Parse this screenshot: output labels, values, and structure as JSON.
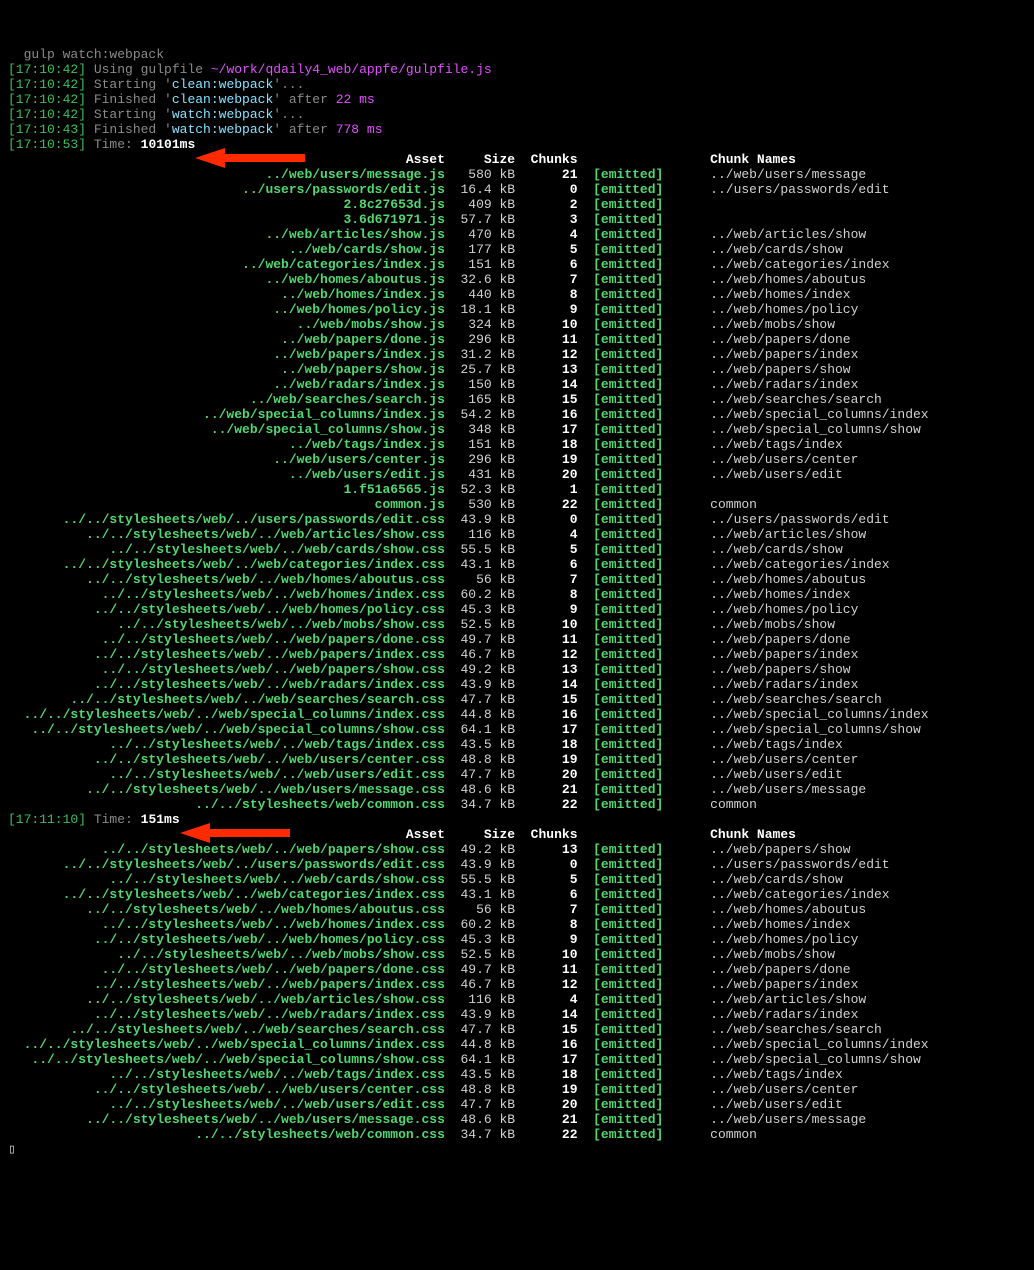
{
  "prompt_fragment": "gulp watch:webpack",
  "log_lines": [
    {
      "ts": "17:10:42",
      "type": "using",
      "text_a": "Using gulpfile ",
      "path": "~/work/qdaily4_web/appfe/gulpfile.js"
    },
    {
      "ts": "17:10:42",
      "type": "starting",
      "task": "clean:webpack"
    },
    {
      "ts": "17:10:42",
      "type": "finished",
      "task": "clean:webpack",
      "after": "22 ms"
    },
    {
      "ts": "17:10:42",
      "type": "starting",
      "task": "watch:webpack"
    },
    {
      "ts": "17:10:43",
      "type": "finished",
      "task": "watch:webpack",
      "after": "778 ms"
    }
  ],
  "build1": {
    "ts": "17:10:53",
    "time": "10101ms",
    "headers": [
      "Asset",
      "Size",
      "Chunks",
      "",
      "Chunk Names"
    ],
    "rows": [
      {
        "asset": "../web/users/message.js",
        "size": "580 kB",
        "chunk": "21",
        "status": "[emitted]",
        "name": "../web/users/message"
      },
      {
        "asset": "../users/passwords/edit.js",
        "size": "16.4 kB",
        "chunk": "0",
        "status": "[emitted]",
        "name": "../users/passwords/edit"
      },
      {
        "asset": "2.8c27653d.js",
        "size": "409 kB",
        "chunk": "2",
        "status": "[emitted]",
        "name": ""
      },
      {
        "asset": "3.6d671971.js",
        "size": "57.7 kB",
        "chunk": "3",
        "status": "[emitted]",
        "name": ""
      },
      {
        "asset": "../web/articles/show.js",
        "size": "470 kB",
        "chunk": "4",
        "status": "[emitted]",
        "name": "../web/articles/show"
      },
      {
        "asset": "../web/cards/show.js",
        "size": "177 kB",
        "chunk": "5",
        "status": "[emitted]",
        "name": "../web/cards/show"
      },
      {
        "asset": "../web/categories/index.js",
        "size": "151 kB",
        "chunk": "6",
        "status": "[emitted]",
        "name": "../web/categories/index"
      },
      {
        "asset": "../web/homes/aboutus.js",
        "size": "32.6 kB",
        "chunk": "7",
        "status": "[emitted]",
        "name": "../web/homes/aboutus"
      },
      {
        "asset": "../web/homes/index.js",
        "size": "440 kB",
        "chunk": "8",
        "status": "[emitted]",
        "name": "../web/homes/index"
      },
      {
        "asset": "../web/homes/policy.js",
        "size": "18.1 kB",
        "chunk": "9",
        "status": "[emitted]",
        "name": "../web/homes/policy"
      },
      {
        "asset": "../web/mobs/show.js",
        "size": "324 kB",
        "chunk": "10",
        "status": "[emitted]",
        "name": "../web/mobs/show"
      },
      {
        "asset": "../web/papers/done.js",
        "size": "296 kB",
        "chunk": "11",
        "status": "[emitted]",
        "name": "../web/papers/done"
      },
      {
        "asset": "../web/papers/index.js",
        "size": "31.2 kB",
        "chunk": "12",
        "status": "[emitted]",
        "name": "../web/papers/index"
      },
      {
        "asset": "../web/papers/show.js",
        "size": "25.7 kB",
        "chunk": "13",
        "status": "[emitted]",
        "name": "../web/papers/show"
      },
      {
        "asset": "../web/radars/index.js",
        "size": "150 kB",
        "chunk": "14",
        "status": "[emitted]",
        "name": "../web/radars/index"
      },
      {
        "asset": "../web/searches/search.js",
        "size": "165 kB",
        "chunk": "15",
        "status": "[emitted]",
        "name": "../web/searches/search"
      },
      {
        "asset": "../web/special_columns/index.js",
        "size": "54.2 kB",
        "chunk": "16",
        "status": "[emitted]",
        "name": "../web/special_columns/index"
      },
      {
        "asset": "../web/special_columns/show.js",
        "size": "348 kB",
        "chunk": "17",
        "status": "[emitted]",
        "name": "../web/special_columns/show"
      },
      {
        "asset": "../web/tags/index.js",
        "size": "151 kB",
        "chunk": "18",
        "status": "[emitted]",
        "name": "../web/tags/index"
      },
      {
        "asset": "../web/users/center.js",
        "size": "296 kB",
        "chunk": "19",
        "status": "[emitted]",
        "name": "../web/users/center"
      },
      {
        "asset": "../web/users/edit.js",
        "size": "431 kB",
        "chunk": "20",
        "status": "[emitted]",
        "name": "../web/users/edit"
      },
      {
        "asset": "1.f51a6565.js",
        "size": "52.3 kB",
        "chunk": "1",
        "status": "[emitted]",
        "name": ""
      },
      {
        "asset": "common.js",
        "size": "530 kB",
        "chunk": "22",
        "status": "[emitted]",
        "name": "common"
      },
      {
        "asset": "../../stylesheets/web/../users/passwords/edit.css",
        "size": "43.9 kB",
        "chunk": "0",
        "status": "[emitted]",
        "name": "../users/passwords/edit"
      },
      {
        "asset": "../../stylesheets/web/../web/articles/show.css",
        "size": "116 kB",
        "chunk": "4",
        "status": "[emitted]",
        "name": "../web/articles/show"
      },
      {
        "asset": "../../stylesheets/web/../web/cards/show.css",
        "size": "55.5 kB",
        "chunk": "5",
        "status": "[emitted]",
        "name": "../web/cards/show"
      },
      {
        "asset": "../../stylesheets/web/../web/categories/index.css",
        "size": "43.1 kB",
        "chunk": "6",
        "status": "[emitted]",
        "name": "../web/categories/index"
      },
      {
        "asset": "../../stylesheets/web/../web/homes/aboutus.css",
        "size": "56 kB",
        "chunk": "7",
        "status": "[emitted]",
        "name": "../web/homes/aboutus"
      },
      {
        "asset": "../../stylesheets/web/../web/homes/index.css",
        "size": "60.2 kB",
        "chunk": "8",
        "status": "[emitted]",
        "name": "../web/homes/index"
      },
      {
        "asset": "../../stylesheets/web/../web/homes/policy.css",
        "size": "45.3 kB",
        "chunk": "9",
        "status": "[emitted]",
        "name": "../web/homes/policy"
      },
      {
        "asset": "../../stylesheets/web/../web/mobs/show.css",
        "size": "52.5 kB",
        "chunk": "10",
        "status": "[emitted]",
        "name": "../web/mobs/show"
      },
      {
        "asset": "../../stylesheets/web/../web/papers/done.css",
        "size": "49.7 kB",
        "chunk": "11",
        "status": "[emitted]",
        "name": "../web/papers/done"
      },
      {
        "asset": "../../stylesheets/web/../web/papers/index.css",
        "size": "46.7 kB",
        "chunk": "12",
        "status": "[emitted]",
        "name": "../web/papers/index"
      },
      {
        "asset": "../../stylesheets/web/../web/papers/show.css",
        "size": "49.2 kB",
        "chunk": "13",
        "status": "[emitted]",
        "name": "../web/papers/show"
      },
      {
        "asset": "../../stylesheets/web/../web/radars/index.css",
        "size": "43.9 kB",
        "chunk": "14",
        "status": "[emitted]",
        "name": "../web/radars/index"
      },
      {
        "asset": "../../stylesheets/web/../web/searches/search.css",
        "size": "47.7 kB",
        "chunk": "15",
        "status": "[emitted]",
        "name": "../web/searches/search"
      },
      {
        "asset": "../../stylesheets/web/../web/special_columns/index.css",
        "size": "44.8 kB",
        "chunk": "16",
        "status": "[emitted]",
        "name": "../web/special_columns/index"
      },
      {
        "asset": "../../stylesheets/web/../web/special_columns/show.css",
        "size": "64.1 kB",
        "chunk": "17",
        "status": "[emitted]",
        "name": "../web/special_columns/show"
      },
      {
        "asset": "../../stylesheets/web/../web/tags/index.css",
        "size": "43.5 kB",
        "chunk": "18",
        "status": "[emitted]",
        "name": "../web/tags/index"
      },
      {
        "asset": "../../stylesheets/web/../web/users/center.css",
        "size": "48.8 kB",
        "chunk": "19",
        "status": "[emitted]",
        "name": "../web/users/center"
      },
      {
        "asset": "../../stylesheets/web/../web/users/edit.css",
        "size": "47.7 kB",
        "chunk": "20",
        "status": "[emitted]",
        "name": "../web/users/edit"
      },
      {
        "asset": "../../stylesheets/web/../web/users/message.css",
        "size": "48.6 kB",
        "chunk": "21",
        "status": "[emitted]",
        "name": "../web/users/message"
      },
      {
        "asset": "../../stylesheets/web/common.css",
        "size": "34.7 kB",
        "chunk": "22",
        "status": "[emitted]",
        "name": "common"
      }
    ]
  },
  "build2": {
    "ts": "17:11:10",
    "time": "151ms",
    "headers": [
      "Asset",
      "Size",
      "Chunks",
      "",
      "Chunk Names"
    ],
    "rows": [
      {
        "asset": "../../stylesheets/web/../web/papers/show.css",
        "size": "49.2 kB",
        "chunk": "13",
        "status": "[emitted]",
        "name": "../web/papers/show"
      },
      {
        "asset": "../../stylesheets/web/../users/passwords/edit.css",
        "size": "43.9 kB",
        "chunk": "0",
        "status": "[emitted]",
        "name": "../users/passwords/edit"
      },
      {
        "asset": "../../stylesheets/web/../web/cards/show.css",
        "size": "55.5 kB",
        "chunk": "5",
        "status": "[emitted]",
        "name": "../web/cards/show"
      },
      {
        "asset": "../../stylesheets/web/../web/categories/index.css",
        "size": "43.1 kB",
        "chunk": "6",
        "status": "[emitted]",
        "name": "../web/categories/index"
      },
      {
        "asset": "../../stylesheets/web/../web/homes/aboutus.css",
        "size": "56 kB",
        "chunk": "7",
        "status": "[emitted]",
        "name": "../web/homes/aboutus"
      },
      {
        "asset": "../../stylesheets/web/../web/homes/index.css",
        "size": "60.2 kB",
        "chunk": "8",
        "status": "[emitted]",
        "name": "../web/homes/index"
      },
      {
        "asset": "../../stylesheets/web/../web/homes/policy.css",
        "size": "45.3 kB",
        "chunk": "9",
        "status": "[emitted]",
        "name": "../web/homes/policy"
      },
      {
        "asset": "../../stylesheets/web/../web/mobs/show.css",
        "size": "52.5 kB",
        "chunk": "10",
        "status": "[emitted]",
        "name": "../web/mobs/show"
      },
      {
        "asset": "../../stylesheets/web/../web/papers/done.css",
        "size": "49.7 kB",
        "chunk": "11",
        "status": "[emitted]",
        "name": "../web/papers/done"
      },
      {
        "asset": "../../stylesheets/web/../web/papers/index.css",
        "size": "46.7 kB",
        "chunk": "12",
        "status": "[emitted]",
        "name": "../web/papers/index"
      },
      {
        "asset": "../../stylesheets/web/../web/articles/show.css",
        "size": "116 kB",
        "chunk": "4",
        "status": "[emitted]",
        "name": "../web/articles/show"
      },
      {
        "asset": "../../stylesheets/web/../web/radars/index.css",
        "size": "43.9 kB",
        "chunk": "14",
        "status": "[emitted]",
        "name": "../web/radars/index"
      },
      {
        "asset": "../../stylesheets/web/../web/searches/search.css",
        "size": "47.7 kB",
        "chunk": "15",
        "status": "[emitted]",
        "name": "../web/searches/search"
      },
      {
        "asset": "../../stylesheets/web/../web/special_columns/index.css",
        "size": "44.8 kB",
        "chunk": "16",
        "status": "[emitted]",
        "name": "../web/special_columns/index"
      },
      {
        "asset": "../../stylesheets/web/../web/special_columns/show.css",
        "size": "64.1 kB",
        "chunk": "17",
        "status": "[emitted]",
        "name": "../web/special_columns/show"
      },
      {
        "asset": "../../stylesheets/web/../web/tags/index.css",
        "size": "43.5 kB",
        "chunk": "18",
        "status": "[emitted]",
        "name": "../web/tags/index"
      },
      {
        "asset": "../../stylesheets/web/../web/users/center.css",
        "size": "48.8 kB",
        "chunk": "19",
        "status": "[emitted]",
        "name": "../web/users/center"
      },
      {
        "asset": "../../stylesheets/web/../web/users/edit.css",
        "size": "47.7 kB",
        "chunk": "20",
        "status": "[emitted]",
        "name": "../web/users/edit"
      },
      {
        "asset": "../../stylesheets/web/../web/users/message.css",
        "size": "48.6 kB",
        "chunk": "21",
        "status": "[emitted]",
        "name": "../web/users/message"
      },
      {
        "asset": "../../stylesheets/web/common.css",
        "size": "34.7 kB",
        "chunk": "22",
        "status": "[emitted]",
        "name": "common"
      }
    ]
  },
  "cursor": "▯"
}
